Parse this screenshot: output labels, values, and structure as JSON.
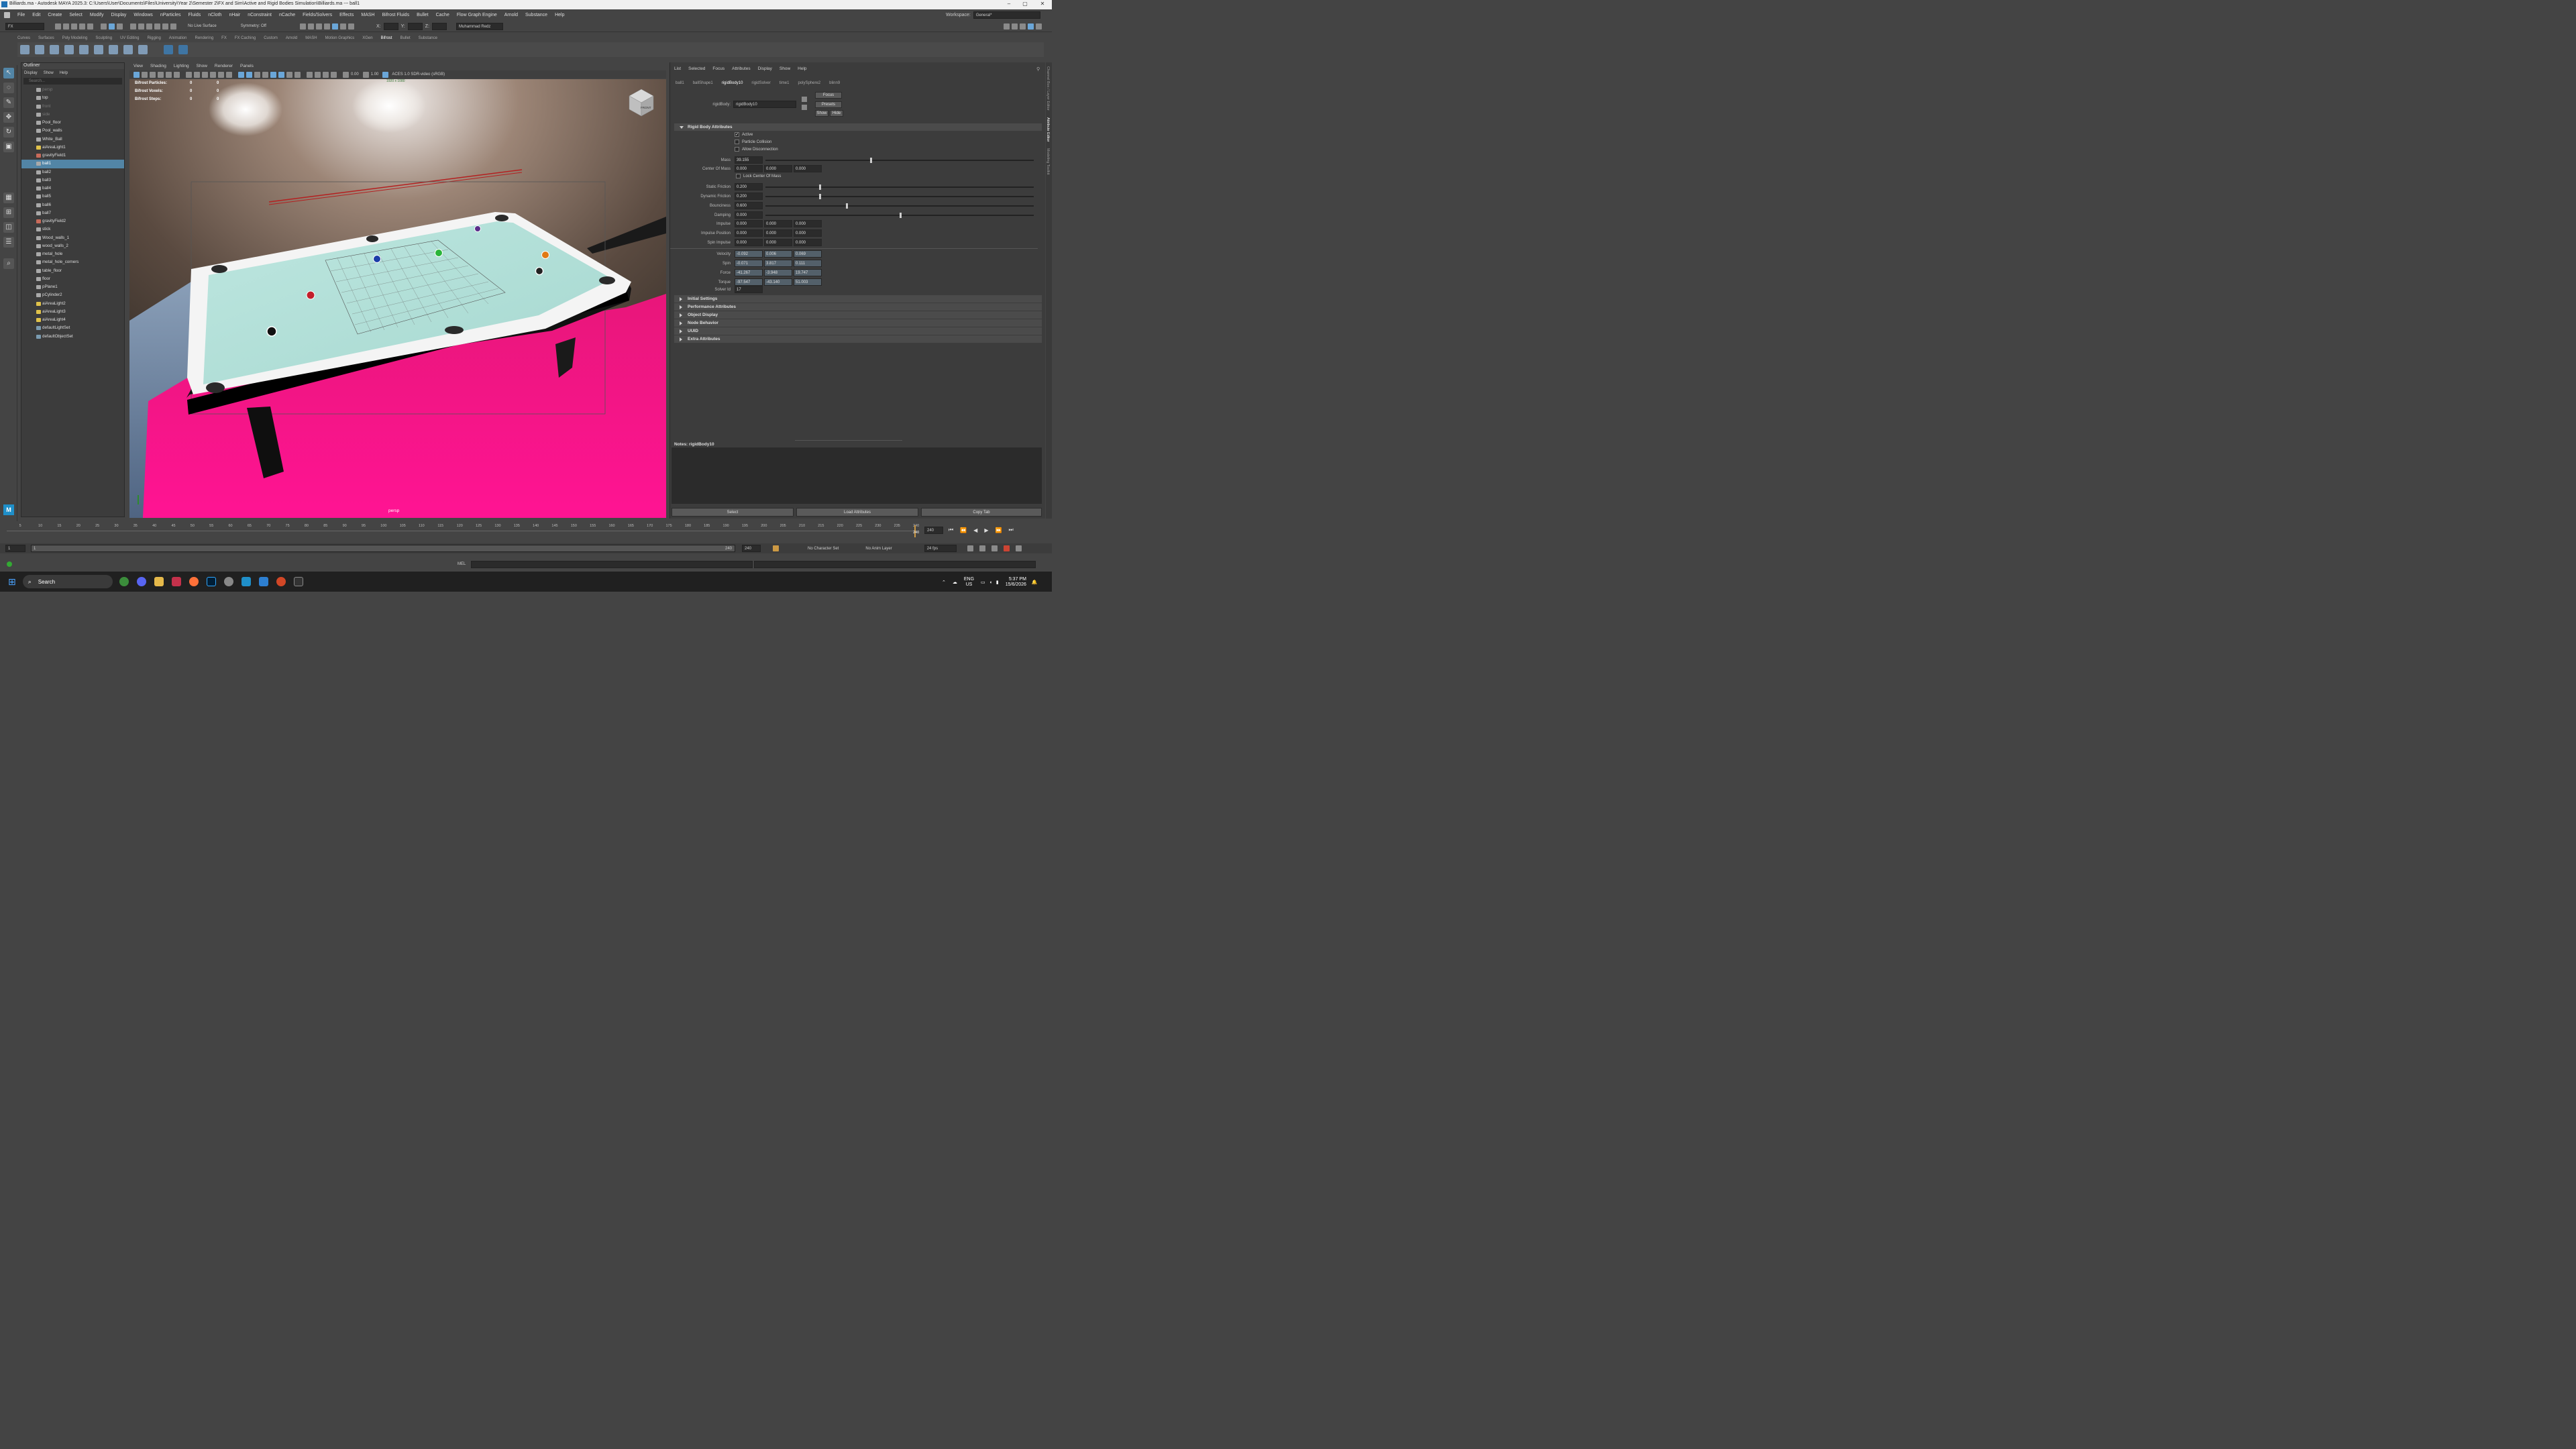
{
  "window": {
    "title": "Billiards.ma - Autodesk MAYA 2025.3: C:\\Users\\User\\Documents\\Files\\University\\Year 2\\Semester 2\\FX and Sim\\Active and Rigid Bodies Simulation\\Billiards.ma  ---  ball1"
  },
  "menus": [
    "File",
    "Edit",
    "Create",
    "Select",
    "Modify",
    "Display",
    "Windows",
    "nParticles",
    "Fluids",
    "nCloth",
    "nHair",
    "nConstraint",
    "nCache",
    "Fields/Solvers",
    "Effects",
    "MASH",
    "Bifrost Fluids",
    "Bullet",
    "Cache",
    "Flow Graph Engine",
    "Arnold",
    "Substance",
    "Help"
  ],
  "workspace": {
    "label": "Workspace:",
    "value": "General*"
  },
  "statusline": {
    "mode": "FX",
    "live_surface": "No Live Surface",
    "symmetry": "Symmetry: Off",
    "x": "X:",
    "y": "Y:",
    "z": "Z:",
    "user": "Muhammad Redz"
  },
  "shelf_tabs": [
    "Curves",
    "Surfaces",
    "Poly Modeling",
    "Sculpting",
    "UV Editing",
    "Rigging",
    "Animation",
    "Rendering",
    "FX",
    "FX Caching",
    "Custom",
    "Arnold",
    "MASH",
    "Motion Graphics",
    "XGen",
    "Bifrost",
    "Bullet",
    "Substance"
  ],
  "shelf_active": "Bifrost",
  "outliner": {
    "title": "Outliner",
    "menu": [
      "Display",
      "Show",
      "Help"
    ],
    "search_placeholder": "Search...",
    "items": [
      {
        "label": "persp",
        "dim": true
      },
      {
        "label": "top",
        "dim": false
      },
      {
        "label": "front",
        "dim": true
      },
      {
        "label": "side",
        "dim": true
      },
      {
        "label": "Pool_floor"
      },
      {
        "label": "Pool_walls"
      },
      {
        "label": "White_Ball"
      },
      {
        "label": "aiAreaLight1"
      },
      {
        "label": "gravityField1"
      },
      {
        "label": "ball1",
        "sel": true
      },
      {
        "label": "ball2"
      },
      {
        "label": "ball3"
      },
      {
        "label": "ball4"
      },
      {
        "label": "ball5"
      },
      {
        "label": "ball6"
      },
      {
        "label": "ball7"
      },
      {
        "label": "gravityField2"
      },
      {
        "label": "stick"
      },
      {
        "label": "Wood_walls_1"
      },
      {
        "label": "wood_walls_2"
      },
      {
        "label": "metal_hole"
      },
      {
        "label": "metal_hole_corners"
      },
      {
        "label": "table_floor"
      },
      {
        "label": "floor"
      },
      {
        "label": "pPlane1"
      },
      {
        "label": "pCylinder2"
      },
      {
        "label": "aiAreaLight2"
      },
      {
        "label": "aiAreaLight3"
      },
      {
        "label": "aiAreaLight4"
      },
      {
        "label": "defaultLightSet"
      },
      {
        "label": "defaultObjectSet"
      }
    ]
  },
  "viewport": {
    "menu": [
      "View",
      "Shading",
      "Lighting",
      "Show",
      "Renderer",
      "Panels"
    ],
    "field1": "0.00",
    "field2": "1.00",
    "colorspace": "ACES 1.0 SDR-video (sRGB)",
    "hud": [
      {
        "label": "Bifrost Particles:",
        "a": "0",
        "b": "0"
      },
      {
        "label": "Bifrost Voxels:",
        "a": "0",
        "b": "0"
      },
      {
        "label": "Bifrost Steps:",
        "a": "0",
        "b": "0"
      }
    ],
    "resolution": "1920 x 1080",
    "camera": "persp",
    "cube": "FRONT"
  },
  "attr": {
    "menu": [
      "List",
      "Selected",
      "Focus",
      "Attributes",
      "Display",
      "Show",
      "Help"
    ],
    "tabs": [
      "ball1",
      "ballShape1",
      "rigidBody10",
      "rigidSolver",
      "time1",
      "polySphere2",
      "blinn9"
    ],
    "active_tab": "rigidBody10",
    "node_label": "rigidBody:",
    "node_value": "rigidBody10",
    "buttons": [
      "Focus",
      "Presets",
      "Show",
      "Hide"
    ],
    "section": "Rigid Body Attributes",
    "checks": [
      {
        "label": "Active",
        "on": true
      },
      {
        "label": "Particle Collision",
        "on": false
      },
      {
        "label": "Allow Disconnection",
        "on": false
      }
    ],
    "mass": {
      "label": "Mass",
      "value": "39.155",
      "slider": 0.39
    },
    "com": {
      "label": "Center Of Mass",
      "values": [
        "0.000",
        "0.000",
        "0.000"
      ]
    },
    "lock_com": "Lock Center Of Mass",
    "sliders": [
      {
        "label": "Static Friction",
        "value": "0.200",
        "pos": 0.2
      },
      {
        "label": "Dynamic Friction",
        "value": "0.200",
        "pos": 0.2
      },
      {
        "label": "Bounciness",
        "value": "0.600",
        "pos": 0.3
      },
      {
        "label": "Damping",
        "value": "0.000",
        "pos": 0.5
      }
    ],
    "vec3": [
      {
        "label": "Impulse",
        "values": [
          "0.000",
          "0.000",
          "0.000"
        ],
        "ro": false
      },
      {
        "label": "Impulse Position",
        "values": [
          "0.000",
          "0.000",
          "0.000"
        ],
        "ro": false
      },
      {
        "label": "Spin Impulse",
        "values": [
          "0.000",
          "0.000",
          "0.000"
        ],
        "ro": false
      },
      {
        "label": "Velocity",
        "values": [
          "-0.092",
          "0.006",
          "0.069"
        ],
        "ro": true
      },
      {
        "label": "Spin",
        "values": [
          "-0.071",
          "3.817",
          "0.111"
        ],
        "ro": true
      },
      {
        "label": "Force",
        "values": [
          "-41.267",
          "-3.948",
          "19.747"
        ],
        "ro": true
      },
      {
        "label": "Torque",
        "values": [
          "-97.547",
          "-43.140",
          "51.003"
        ],
        "ro": true
      }
    ],
    "solver": {
      "label": "Solver Id",
      "value": "17"
    },
    "collapsed": [
      "Initial Settings",
      "Performance Attributes",
      "Object Display",
      "Node Behavior",
      "UUID",
      "Extra Attributes"
    ],
    "notes": "Notes: rigidBody10",
    "bottom": [
      "Select",
      "Load Attributes",
      "Copy Tab"
    ],
    "side_tabs": [
      "Channel Box / Layer Editor",
      "Attribute Editor",
      "Modeling Toolkit"
    ]
  },
  "timeline": {
    "ticks": [
      "5",
      "10",
      "15",
      "20",
      "25",
      "30",
      "35",
      "40",
      "45",
      "50",
      "55",
      "60",
      "65",
      "70",
      "75",
      "80",
      "85",
      "90",
      "95",
      "100",
      "105",
      "110",
      "115",
      "120",
      "125",
      "130",
      "135",
      "140",
      "145",
      "150",
      "155",
      "160",
      "165",
      "170",
      "175",
      "180",
      "185",
      "190",
      "195",
      "200",
      "205",
      "210",
      "215",
      "220",
      "225",
      "230",
      "235",
      "240"
    ],
    "current": "240",
    "end_field": "240"
  },
  "range": {
    "start": "1",
    "start2": "1",
    "end": "240",
    "end2": "240",
    "char_set": "No Character Set",
    "anim_layer": "No Anim Layer",
    "fps": "24 fps"
  },
  "cmd": {
    "label": "MEL"
  },
  "taskbar": {
    "search": "Search",
    "lang1": "ENG",
    "lang2": "US",
    "time": "5:37 PM",
    "date": "15/6/2026"
  }
}
